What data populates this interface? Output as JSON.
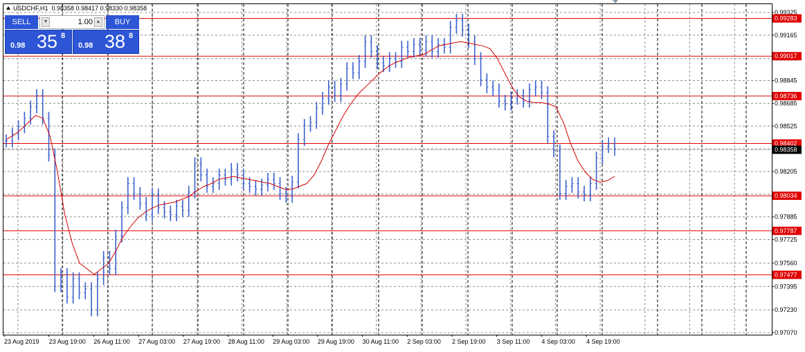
{
  "symbol": {
    "title": "USDCHF,H1",
    "ohlc": "0.98358 0.98417 0.98330 0.98358"
  },
  "trade_panel": {
    "sell_label": "SELL",
    "buy_label": "BUY",
    "lot_value": "1.00",
    "sell_price": {
      "prefix": "0.98",
      "big": "35",
      "sup": "8"
    },
    "buy_price": {
      "prefix": "0.98",
      "big": "38",
      "sup": "8"
    }
  },
  "colors": {
    "panel_blue": "#2d55d6",
    "candle": "#3a5fcd",
    "ma_line": "#d40000",
    "level_line": "#e00000",
    "grid": "#8c8c8c"
  },
  "chart_data": {
    "type": "line",
    "title": "",
    "xlabel": "",
    "ylabel": "",
    "ylim": [
      0.9707,
      0.99325
    ],
    "grid": true,
    "y_ticks": [
      "0.99325",
      "0.99165",
      "0.99000",
      "0.98845",
      "0.98685",
      "0.98525",
      "0.98365",
      "0.98205",
      "0.98045",
      "0.97885",
      "0.97725",
      "0.97560",
      "0.97395",
      "0.97230",
      "0.97070"
    ],
    "x_ticks": [
      "23 Aug 2019",
      "23 Aug 19:00",
      "26 Aug 11:00",
      "27 Aug 03:00",
      "27 Aug 19:00",
      "28 Aug 11:00",
      "29 Aug 03:00",
      "29 Aug 19:00",
      "30 Aug 11:00",
      "2 Sep 03:00",
      "2 Sep 19:00",
      "3 Sep 11:00",
      "4 Sep 03:00",
      "4 Sep 19:00"
    ],
    "levels": [
      "0.99283",
      "0.99017",
      "0.98736",
      "0.98402",
      "0.98034",
      "0.97787",
      "0.97477"
    ],
    "current_price": "0.98358",
    "series": [
      {
        "kind": "close",
        "values": [
          0.9842,
          0.9847,
          0.9852,
          0.9858,
          0.9866,
          0.9874,
          0.9858,
          0.9832,
          0.974,
          0.9748,
          0.9732,
          0.9745,
          0.9735,
          0.9738,
          0.9723,
          0.9745,
          0.976,
          0.9752,
          0.9775,
          0.9795,
          0.9812,
          0.9805,
          0.9798,
          0.979,
          0.9804,
          0.9795,
          0.9792,
          0.979,
          0.9796,
          0.9793,
          0.9806,
          0.9826,
          0.9818,
          0.981,
          0.9812,
          0.9818,
          0.9815,
          0.9822,
          0.9818,
          0.9812,
          0.981,
          0.9808,
          0.9811,
          0.9815,
          0.9812,
          0.9805,
          0.9803,
          0.9813,
          0.9843,
          0.9853,
          0.9855,
          0.9865,
          0.9872,
          0.988,
          0.9874,
          0.9882,
          0.9893,
          0.989,
          0.9898,
          0.9912,
          0.9905,
          0.9897,
          0.9895,
          0.99,
          0.9898,
          0.9908,
          0.9905,
          0.991,
          0.9906,
          0.9912,
          0.9905,
          0.991,
          0.9908,
          0.9922,
          0.9927,
          0.992,
          0.9912,
          0.99,
          0.9885,
          0.988,
          0.9878,
          0.987,
          0.9868,
          0.9872,
          0.9874,
          0.987,
          0.9878,
          0.988,
          0.9876,
          0.9845,
          0.9835,
          0.9805,
          0.981,
          0.9812,
          0.9806,
          0.9804,
          0.9812,
          0.983,
          0.9838,
          0.984,
          0.9836
        ]
      },
      {
        "kind": "moving-average",
        "values": [
          0.9843,
          0.9846,
          0.985,
          0.9855,
          0.986,
          0.9858,
          0.9845,
          0.982,
          0.979,
          0.977,
          0.9756,
          0.9752,
          0.9748,
          0.9752,
          0.9756,
          0.9765,
          0.9775,
          0.9782,
          0.9788,
          0.9792,
          0.9795,
          0.9797,
          0.9798,
          0.9799,
          0.9801,
          0.9803,
          0.9807,
          0.981,
          0.9812,
          0.9815,
          0.9816,
          0.9817,
          0.9816,
          0.9815,
          0.9814,
          0.9813,
          0.9812,
          0.981,
          0.9808,
          0.9808,
          0.981,
          0.9812,
          0.9818,
          0.9828,
          0.984,
          0.985,
          0.986,
          0.9868,
          0.9875,
          0.988,
          0.9885,
          0.989,
          0.9894,
          0.9897,
          0.9899,
          0.9901,
          0.9902,
          0.9903,
          0.9906,
          0.9909,
          0.991,
          0.9911,
          0.9912,
          0.9911,
          0.991,
          0.9909,
          0.9907,
          0.99,
          0.989,
          0.988,
          0.9873,
          0.987,
          0.9869,
          0.9869,
          0.9868,
          0.9866,
          0.9855,
          0.984,
          0.9828,
          0.982,
          0.9815,
          0.9813,
          0.9814,
          0.9817
        ]
      }
    ]
  }
}
